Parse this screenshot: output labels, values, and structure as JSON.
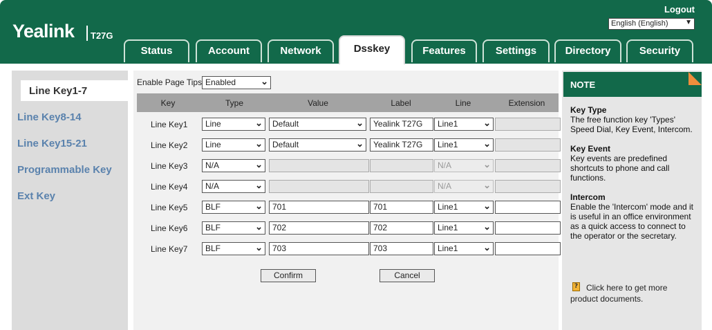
{
  "header": {
    "brand": "Yealink",
    "model": "T27G",
    "logout": "Logout",
    "language": "English (English)"
  },
  "tabs": [
    "Status",
    "Account",
    "Network",
    "Dsskey",
    "Features",
    "Settings",
    "Directory",
    "Security"
  ],
  "active_tab": "Dsskey",
  "sidebar": {
    "items": [
      "Line Key1-7",
      "Line Key8-14",
      "Line Key15-21",
      "Programmable Key",
      "Ext Key"
    ],
    "active": "Line Key1-7"
  },
  "page_tips": {
    "label": "Enable Page Tips",
    "value": "Enabled"
  },
  "table": {
    "headers": [
      "Key",
      "Type",
      "Value",
      "Label",
      "Line",
      "Extension"
    ],
    "rows": [
      {
        "key": "Line Key1",
        "type": "Line",
        "value": "Default",
        "label": "Yealink T27G",
        "line": "Line1",
        "extension": "",
        "value_select": true,
        "disabled": false
      },
      {
        "key": "Line Key2",
        "type": "Line",
        "value": "Default",
        "label": "Yealink T27G",
        "line": "Line1",
        "extension": "",
        "value_select": true,
        "disabled": false
      },
      {
        "key": "Line Key3",
        "type": "N/A",
        "value": "",
        "label": "",
        "line": "N/A",
        "extension": "",
        "value_select": false,
        "disabled": true
      },
      {
        "key": "Line Key4",
        "type": "N/A",
        "value": "",
        "label": "",
        "line": "N/A",
        "extension": "",
        "value_select": false,
        "disabled": true
      },
      {
        "key": "Line Key5",
        "type": "BLF",
        "value": "701",
        "label": "701",
        "line": "Line1",
        "extension": "",
        "value_select": false,
        "disabled": false
      },
      {
        "key": "Line Key6",
        "type": "BLF",
        "value": "702",
        "label": "702",
        "line": "Line1",
        "extension": "",
        "value_select": false,
        "disabled": false
      },
      {
        "key": "Line Key7",
        "type": "BLF",
        "value": "703",
        "label": "703",
        "line": "Line1",
        "extension": "",
        "value_select": false,
        "disabled": false
      }
    ]
  },
  "buttons": {
    "confirm": "Confirm",
    "cancel": "Cancel"
  },
  "note": {
    "title": "NOTE",
    "sections": [
      {
        "heading": "Key Type",
        "text": "The free function key 'Types' Speed Dial, Key Event, Intercom."
      },
      {
        "heading": "Key Event",
        "text": "Key events are predefined shortcuts to phone and call functions."
      },
      {
        "heading": "Intercom",
        "text": "Enable the 'Intercom' mode and it is useful in an office environment as a quick access to connect to the operator or the secretary."
      }
    ],
    "doc_link": "Click here to get more product documents."
  },
  "colors": {
    "brand_green": "#12694a",
    "nav_link": "#5a82ad",
    "note_corner": "#ef8d3c"
  }
}
